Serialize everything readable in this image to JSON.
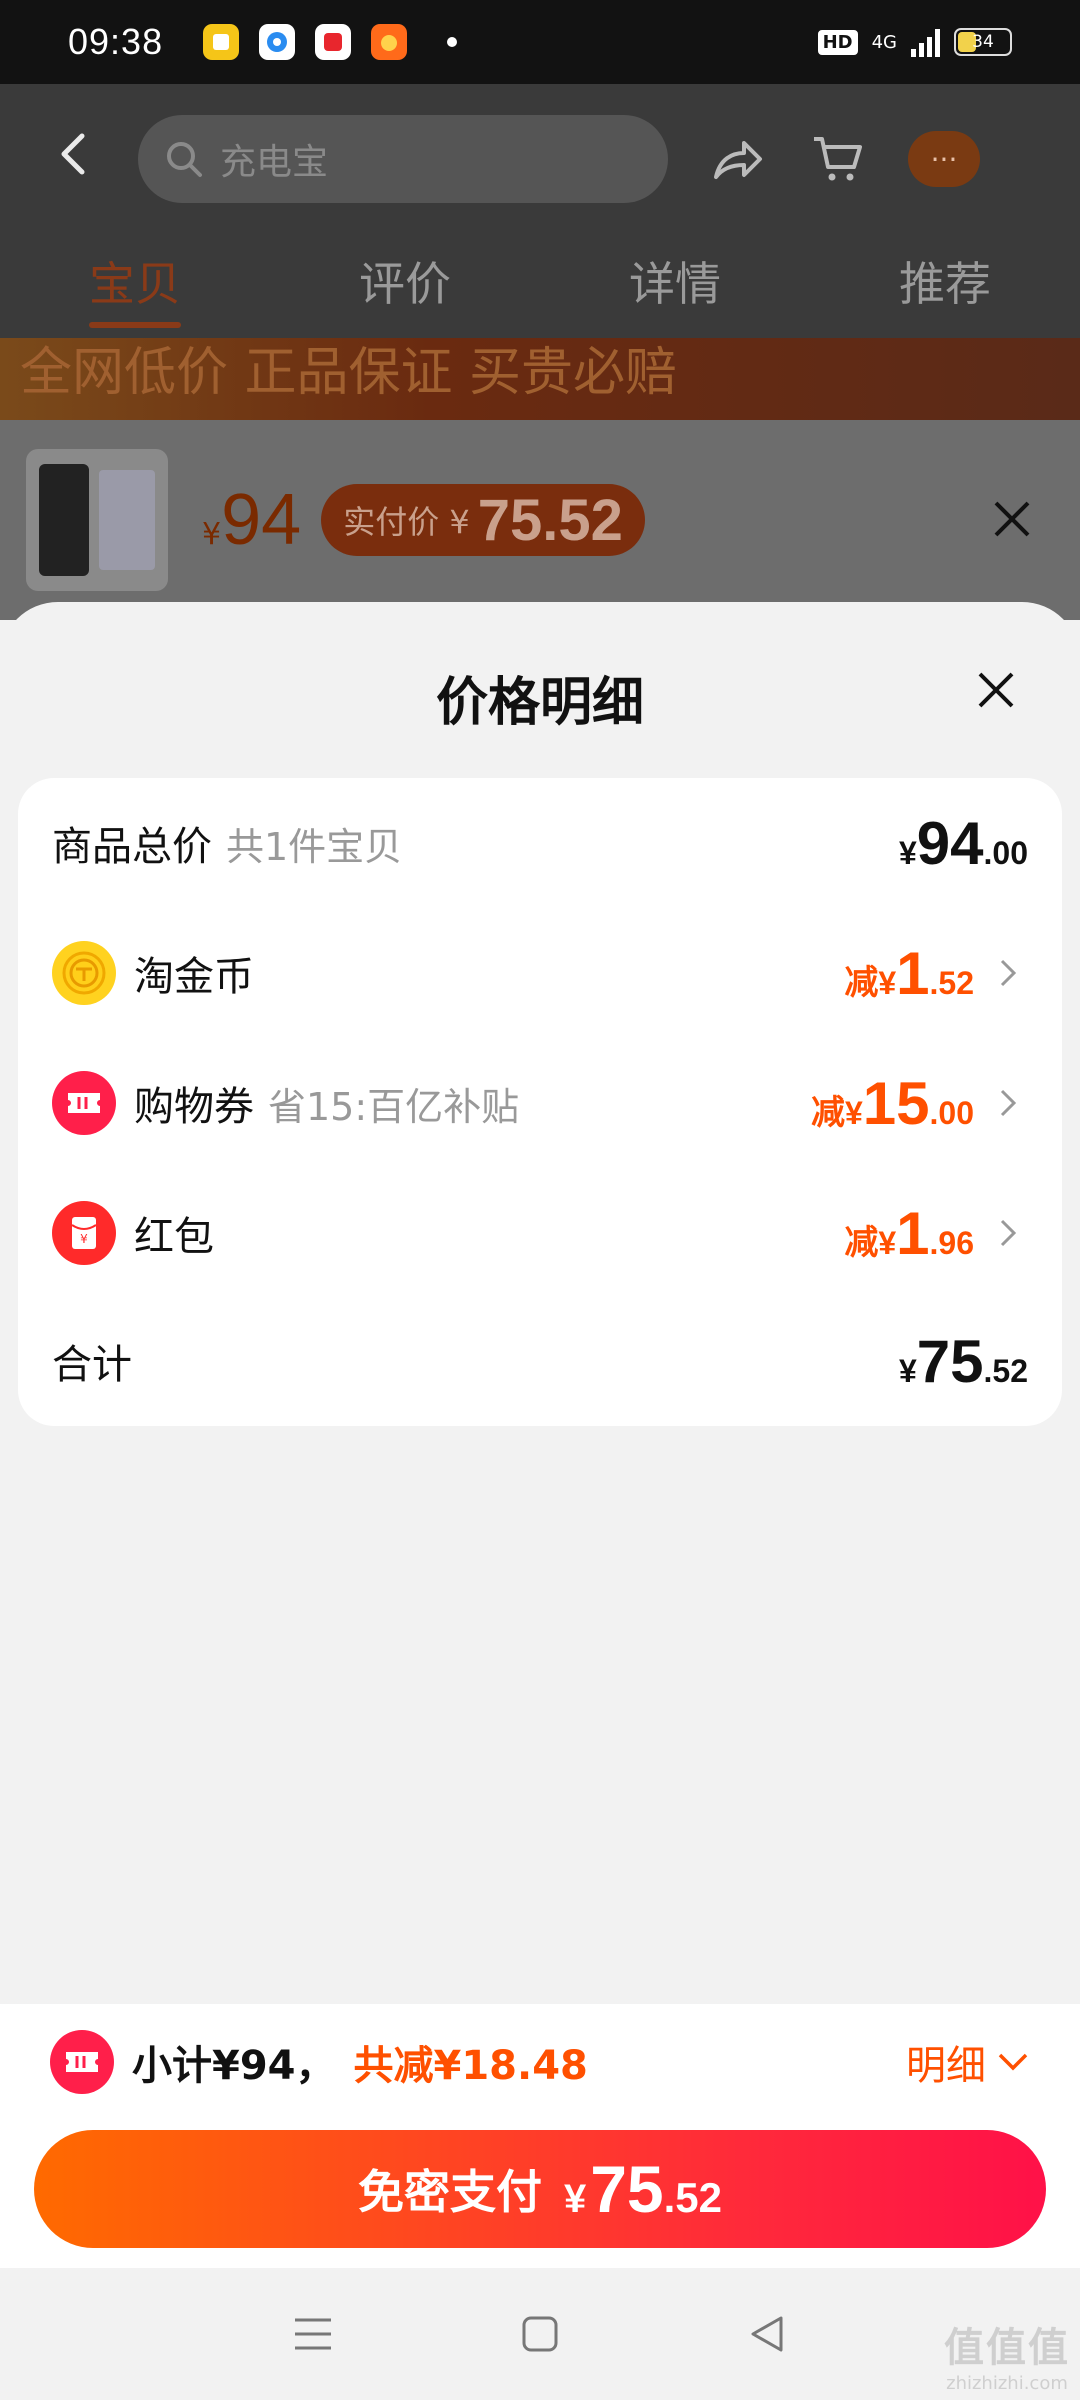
{
  "status_bar": {
    "time": "09:38",
    "hd": "HD",
    "network": "4G",
    "battery": "34"
  },
  "background_page": {
    "search_placeholder": "充电宝",
    "tabs": [
      "宝贝",
      "评价",
      "详情",
      "推荐"
    ],
    "more_label": "···",
    "banner_text": "全网低价  正品保证  买贵必赔",
    "mini_bar": {
      "currency": "¥",
      "price": "94",
      "pay_label": "实付价 ¥",
      "pay_value": "75.52"
    }
  },
  "sheet": {
    "title": "价格明细",
    "rows": {
      "total": {
        "label": "商品总价",
        "sub": "共1件宝贝",
        "currency": "¥",
        "int": "94",
        "dec": ".00"
      },
      "coins": {
        "label": "淘金币",
        "prefix": "减",
        "currency": "¥",
        "int": "1",
        "dec": ".52"
      },
      "coupon": {
        "label": "购物券",
        "sub": "省15:百亿补贴",
        "prefix": "减",
        "currency": "¥",
        "int": "15",
        "dec": ".00"
      },
      "redpacket": {
        "label": "红包",
        "prefix": "减",
        "currency": "¥",
        "int": "1",
        "dec": ".96"
      },
      "sum": {
        "label": "合计",
        "currency": "¥",
        "int": "75",
        "dec": ".52"
      }
    }
  },
  "bottom": {
    "subtotal": "小计¥94，",
    "discount": "共减¥18.48",
    "detail_label": "明细",
    "pay_label": "免密支付",
    "pay_currency": "¥",
    "pay_int": "75",
    "pay_dec": ".52"
  },
  "watermark": {
    "line1": "值值值",
    "line2": "zhizhizhi.com"
  },
  "colors": {
    "accent": "#ff5000",
    "pay_gradient_start": "#ff6a00",
    "pay_gradient_end": "#ff1148"
  }
}
